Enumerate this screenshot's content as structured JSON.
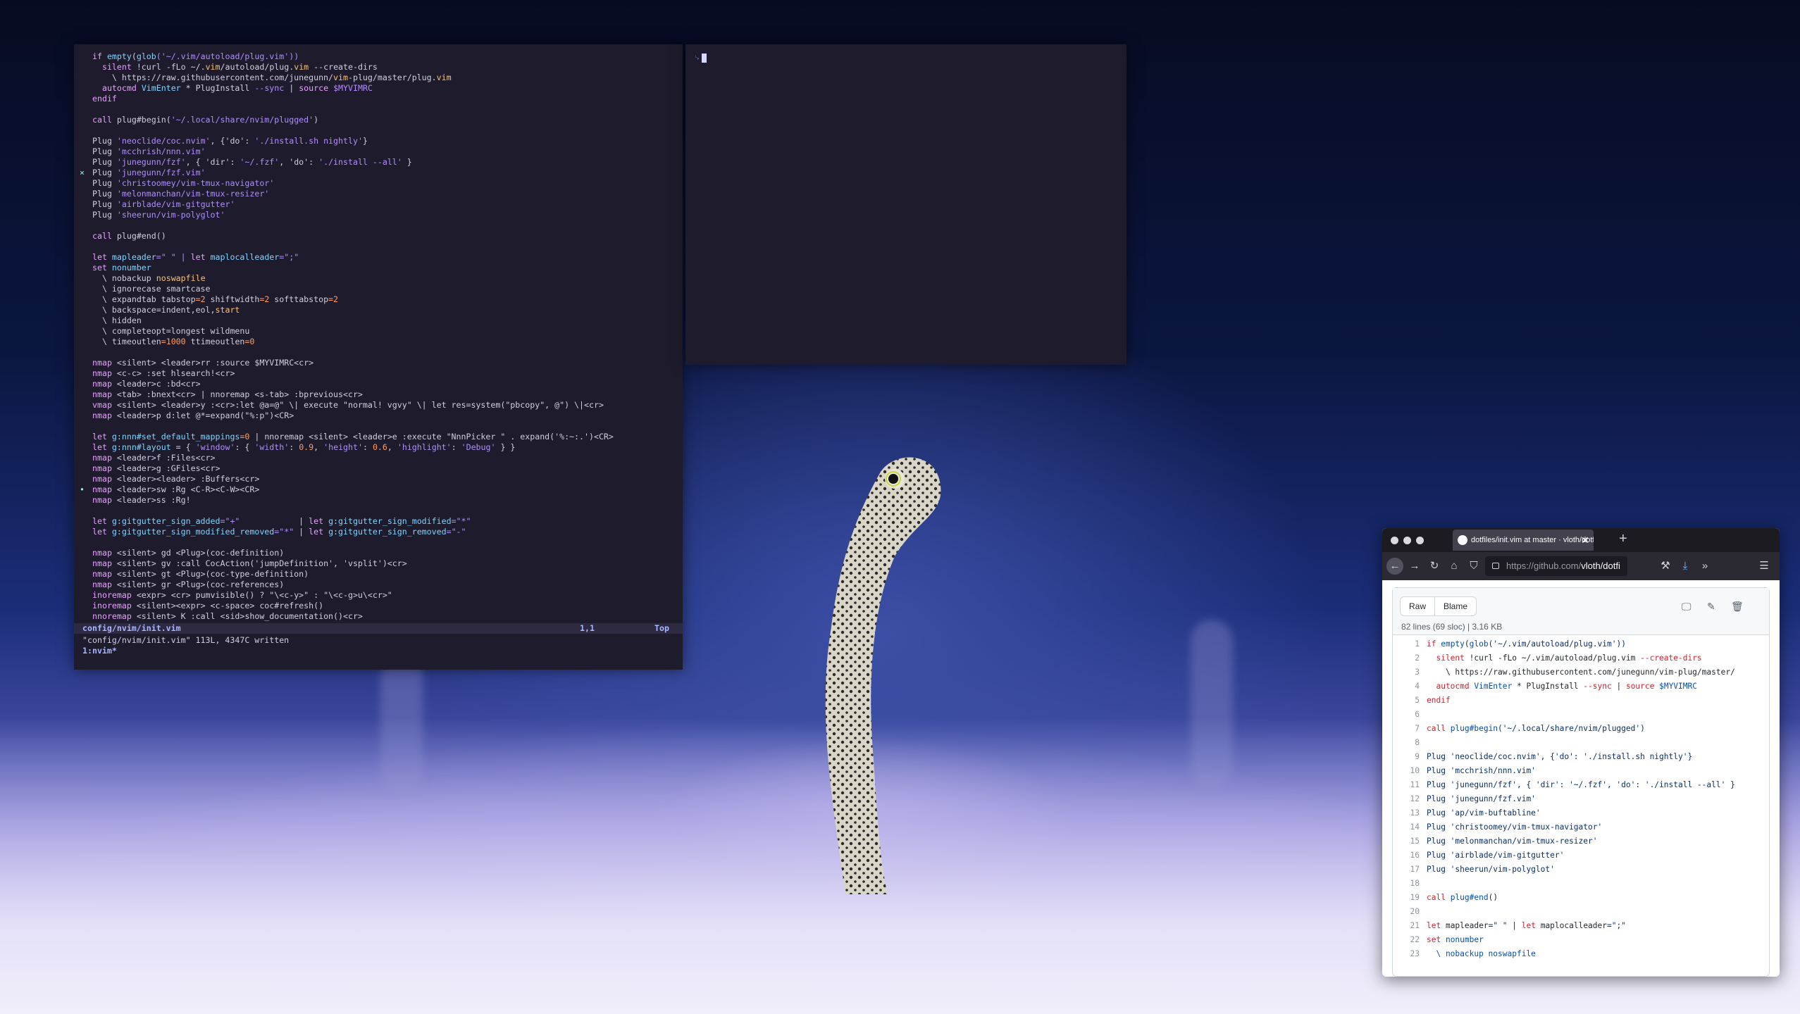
{
  "terminal": {
    "lines": [
      [
        {
          "t": "if ",
          "c": "k"
        },
        {
          "t": "empty",
          "c": "f"
        },
        {
          "t": "(",
          "c": ""
        },
        {
          "t": "glob",
          "c": "f"
        },
        {
          "t": "('~/.vim/autoload/plug.vim'))",
          "c": "s"
        }
      ],
      [
        {
          "t": "  silent ",
          "c": "k"
        },
        {
          "t": "!curl -fLo ~/.",
          "c": ""
        },
        {
          "t": "vim",
          "c": "o"
        },
        {
          "t": "/autoload/plug.",
          "c": ""
        },
        {
          "t": "vim",
          "c": "o"
        },
        {
          "t": " --create-dirs",
          "c": ""
        }
      ],
      [
        {
          "t": "    \\ https://raw.githubusercontent.com/junegunn/",
          "c": ""
        },
        {
          "t": "vim",
          "c": "o"
        },
        {
          "t": "-plug/master/plug.",
          "c": ""
        },
        {
          "t": "vim",
          "c": "o"
        }
      ],
      [
        {
          "t": "  autocmd ",
          "c": "k"
        },
        {
          "t": "VimEnter",
          "c": "f"
        },
        {
          "t": " * PlugInstall ",
          "c": ""
        },
        {
          "t": "--sync",
          "c": "s"
        },
        {
          "t": " | ",
          "c": ""
        },
        {
          "t": "source",
          "c": "k"
        },
        {
          "t": " $MYVIMRC",
          "c": "s"
        }
      ],
      [
        {
          "t": "endif",
          "c": "k"
        }
      ],
      [
        {
          "t": "",
          "c": ""
        }
      ],
      [
        {
          "t": "call ",
          "c": "k"
        },
        {
          "t": "plug#begin(",
          "c": ""
        },
        {
          "t": "'~/.local/share/nvim/plugged'",
          "c": "s"
        },
        {
          "t": ")",
          "c": ""
        }
      ],
      [
        {
          "t": "",
          "c": ""
        }
      ],
      [
        {
          "t": "Plug ",
          "c": ""
        },
        {
          "t": "'neoclide/coc.nvim'",
          "c": "s"
        },
        {
          "t": ", {'do': ",
          "c": ""
        },
        {
          "t": "'./install.sh nightly'",
          "c": "s"
        },
        {
          "t": "}",
          "c": ""
        }
      ],
      [
        {
          "t": "Plug ",
          "c": ""
        },
        {
          "t": "'mcchrish/nnn.vim'",
          "c": "s"
        }
      ],
      [
        {
          "t": "Plug ",
          "c": ""
        },
        {
          "t": "'junegunn/fzf'",
          "c": "s"
        },
        {
          "t": ", { 'dir': ",
          "c": ""
        },
        {
          "t": "'~/.fzf'",
          "c": "s"
        },
        {
          "t": ", 'do': ",
          "c": ""
        },
        {
          "t": "'./install --all'",
          "c": "s"
        },
        {
          "t": " }",
          "c": ""
        }
      ],
      [
        {
          "t": "Plug ",
          "c": ""
        },
        {
          "t": "'junegunn/fzf.vim'",
          "c": "s"
        }
      ],
      [
        {
          "t": "Plug ",
          "c": ""
        },
        {
          "t": "'christoomey/vim-tmux-navigator'",
          "c": "s"
        }
      ],
      [
        {
          "t": "Plug ",
          "c": ""
        },
        {
          "t": "'melonmanchan/vim-tmux-resizer'",
          "c": "s"
        }
      ],
      [
        {
          "t": "Plug ",
          "c": ""
        },
        {
          "t": "'airblade/vim-gitgutter'",
          "c": "s"
        }
      ],
      [
        {
          "t": "Plug ",
          "c": ""
        },
        {
          "t": "'sheerun/vim-polyglot'",
          "c": "s"
        }
      ],
      [
        {
          "t": "",
          "c": ""
        }
      ],
      [
        {
          "t": "call ",
          "c": "k"
        },
        {
          "t": "plug#end()",
          "c": ""
        }
      ],
      [
        {
          "t": "",
          "c": ""
        }
      ],
      [
        {
          "t": "let ",
          "c": "k"
        },
        {
          "t": "mapleader",
          "c": "f"
        },
        {
          "t": "=\" \" | ",
          "c": "s"
        },
        {
          "t": "let ",
          "c": "k"
        },
        {
          "t": "maplocalleader",
          "c": "f"
        },
        {
          "t": "=\";\"",
          "c": "s"
        }
      ],
      [
        {
          "t": "set ",
          "c": "k"
        },
        {
          "t": "nonumber",
          "c": "f"
        }
      ],
      [
        {
          "t": "  \\ nobackup ",
          "c": ""
        },
        {
          "t": "noswapfile",
          "c": "o"
        }
      ],
      [
        {
          "t": "  \\ ignorecase smartcase",
          "c": ""
        }
      ],
      [
        {
          "t": "  \\ expandtab tabstop",
          "c": ""
        },
        {
          "t": "=2",
          "c": "n"
        },
        {
          "t": " shiftwidth",
          "c": ""
        },
        {
          "t": "=2",
          "c": "n"
        },
        {
          "t": " softtabstop",
          "c": ""
        },
        {
          "t": "=2",
          "c": "n"
        }
      ],
      [
        {
          "t": "  \\ backspace=indent,eol,",
          "c": ""
        },
        {
          "t": "start",
          "c": "o"
        }
      ],
      [
        {
          "t": "  \\ hidden",
          "c": ""
        }
      ],
      [
        {
          "t": "  \\ completeopt=longest wildmenu",
          "c": ""
        }
      ],
      [
        {
          "t": "  \\ timeoutlen",
          "c": ""
        },
        {
          "t": "=1000",
          "c": "n"
        },
        {
          "t": " ttimeoutlen",
          "c": ""
        },
        {
          "t": "=0",
          "c": "n"
        }
      ],
      [
        {
          "t": "",
          "c": ""
        }
      ],
      [
        {
          "t": "nmap ",
          "c": "k"
        },
        {
          "t": "<silent> <leader>rr :source $MYVIMRC<cr>",
          "c": ""
        }
      ],
      [
        {
          "t": "nmap ",
          "c": "k"
        },
        {
          "t": "<c-c> :set hlsearch!<cr>",
          "c": ""
        }
      ],
      [
        {
          "t": "nmap ",
          "c": "k"
        },
        {
          "t": "<leader>c :bd<cr>",
          "c": ""
        }
      ],
      [
        {
          "t": "nmap ",
          "c": "k"
        },
        {
          "t": "<tab> :bnext<cr> | nnoremap <s-tab> :bprevious<cr>",
          "c": ""
        }
      ],
      [
        {
          "t": "vmap ",
          "c": "k"
        },
        {
          "t": "<silent> <leader>y :<cr>:let @a=@\" \\| execute \"normal! vgvy\" \\| let res=system(\"pbcopy\", @\") \\|<cr>",
          "c": ""
        }
      ],
      [
        {
          "t": "nmap ",
          "c": "k"
        },
        {
          "t": "<leader>p d:let @*=expand(\"%:p\")<CR>",
          "c": ""
        }
      ],
      [
        {
          "t": "",
          "c": ""
        }
      ],
      [
        {
          "t": "let ",
          "c": "k"
        },
        {
          "t": "g:nnn#set_default_mappings",
          "c": "f"
        },
        {
          "t": "=0",
          "c": "n"
        },
        {
          "t": " | nnoremap <silent> <leader>e :execute \"NnnPicker \" . expand('%:~:.')<CR>",
          "c": ""
        }
      ],
      [
        {
          "t": "let ",
          "c": "k"
        },
        {
          "t": "g:nnn#layout",
          "c": "f"
        },
        {
          "t": " = { ",
          "c": ""
        },
        {
          "t": "'window'",
          "c": "s"
        },
        {
          "t": ": { ",
          "c": ""
        },
        {
          "t": "'width'",
          "c": "s"
        },
        {
          "t": ": ",
          "c": ""
        },
        {
          "t": "0.9",
          "c": "n"
        },
        {
          "t": ", ",
          "c": ""
        },
        {
          "t": "'height'",
          "c": "s"
        },
        {
          "t": ": ",
          "c": ""
        },
        {
          "t": "0.6",
          "c": "n"
        },
        {
          "t": ", ",
          "c": ""
        },
        {
          "t": "'highlight'",
          "c": "s"
        },
        {
          "t": ": ",
          "c": ""
        },
        {
          "t": "'Debug'",
          "c": "s"
        },
        {
          "t": " } }",
          "c": ""
        }
      ],
      [
        {
          "t": "nmap ",
          "c": "k"
        },
        {
          "t": "<leader>f :Files<cr>",
          "c": ""
        }
      ],
      [
        {
          "t": "nmap ",
          "c": "k"
        },
        {
          "t": "<leader>g :GFiles<cr>",
          "c": ""
        }
      ],
      [
        {
          "t": "nmap ",
          "c": "k"
        },
        {
          "t": "<leader><leader> :Buffers<cr>",
          "c": ""
        }
      ],
      [
        {
          "t": "nmap ",
          "c": "k"
        },
        {
          "t": "<leader>sw :Rg <C-R><C-W><CR>",
          "c": ""
        }
      ],
      [
        {
          "t": "nmap ",
          "c": "k"
        },
        {
          "t": "<leader>ss :Rg!",
          "c": ""
        }
      ],
      [
        {
          "t": "",
          "c": ""
        }
      ],
      [
        {
          "t": "let ",
          "c": "k"
        },
        {
          "t": "g:gitgutter_sign_added",
          "c": "f"
        },
        {
          "t": "=\"+\"",
          "c": "s"
        },
        {
          "t": "            | ",
          "c": ""
        },
        {
          "t": "let ",
          "c": "k"
        },
        {
          "t": "g:gitgutter_sign_modified",
          "c": "f"
        },
        {
          "t": "=\"*\"",
          "c": "s"
        }
      ],
      [
        {
          "t": "let ",
          "c": "k"
        },
        {
          "t": "g:gitgutter_sign_modified_removed",
          "c": "f"
        },
        {
          "t": "=\"*\"",
          "c": "s"
        },
        {
          "t": " | ",
          "c": ""
        },
        {
          "t": "let ",
          "c": "k"
        },
        {
          "t": "g:gitgutter_sign_removed",
          "c": "f"
        },
        {
          "t": "=\"-\"",
          "c": "s"
        }
      ],
      [
        {
          "t": "",
          "c": ""
        }
      ],
      [
        {
          "t": "nmap ",
          "c": "k"
        },
        {
          "t": "<silent> gd <Plug>(coc-definition)",
          "c": ""
        }
      ],
      [
        {
          "t": "nmap ",
          "c": "k"
        },
        {
          "t": "<silent> gv :call CocAction('jumpDefinition', 'vsplit')<cr>",
          "c": ""
        }
      ],
      [
        {
          "t": "nmap ",
          "c": "k"
        },
        {
          "t": "<silent> gt <Plug>(coc-type-definition)",
          "c": ""
        }
      ],
      [
        {
          "t": "nmap ",
          "c": "k"
        },
        {
          "t": "<silent> gr <Plug>(coc-references)",
          "c": ""
        }
      ],
      [
        {
          "t": "inoremap ",
          "c": "k"
        },
        {
          "t": "<expr> <cr> pumvisible() ? \"\\<c-y>\" : \"\\<c-g>u\\<cr>\"",
          "c": ""
        }
      ],
      [
        {
          "t": "inoremap ",
          "c": "k"
        },
        {
          "t": "<silent><expr> <c-space> coc#refresh()",
          "c": ""
        }
      ],
      [
        {
          "t": "nnoremap ",
          "c": "k"
        },
        {
          "t": "<silent> K :call <sid>show_documentation()<cr>",
          "c": ""
        }
      ]
    ],
    "gutter_marks": {
      "11": "×",
      "41": "•"
    },
    "status_file": "config/nvim/init.vim",
    "status_pos": "1,1",
    "status_scroll": "Top",
    "message": "\"config/nvim/init.vim\" 113L, 4347C written",
    "tmux_window": "1:nvim*"
  },
  "terminal2": {
    "prompt": "␊"
  },
  "browser": {
    "tab_title": "dotfiles/init.vim at master · vloth/dotfiles",
    "url_host": "https://github.com/",
    "url_path": "vloth/dotfi",
    "raw_label": "Raw",
    "blame_label": "Blame",
    "lines_info": "82 lines (69 sloc)  |  3.16 KB",
    "icons": [
      "desktop-icon",
      "pencil-icon",
      "trash-icon"
    ],
    "code": [
      {
        "n": "1",
        "h": [
          {
            "t": "if ",
            "c": "gk"
          },
          {
            "t": "empty",
            "c": "gf"
          },
          {
            "t": "(",
            "c": ""
          },
          {
            "t": "glob",
            "c": "gf"
          },
          {
            "t": "('~/.vim/autoload/plug.vim'))",
            "c": "gs"
          }
        ]
      },
      {
        "n": "2",
        "h": [
          {
            "t": "  silent ",
            "c": "gk"
          },
          {
            "t": "!curl -fLo ~/.vim/autoload/plug.vim ",
            "c": ""
          },
          {
            "t": "--create-dirs",
            "c": "gk"
          }
        ]
      },
      {
        "n": "3",
        "h": [
          {
            "t": "    \\ https://raw.githubusercontent.com/junegunn/vim-plug/master/",
            "c": ""
          }
        ]
      },
      {
        "n": "4",
        "h": [
          {
            "t": "  autocmd ",
            "c": "gk"
          },
          {
            "t": "VimEnter",
            "c": "gf"
          },
          {
            "t": " * PlugInstall ",
            "c": ""
          },
          {
            "t": "--sync",
            "c": "gk"
          },
          {
            "t": " | ",
            "c": ""
          },
          {
            "t": "source",
            "c": "gk"
          },
          {
            "t": " $MYVIMRC",
            "c": "gf"
          }
        ]
      },
      {
        "n": "5",
        "h": [
          {
            "t": "endif",
            "c": "gk"
          }
        ]
      },
      {
        "n": "6",
        "h": []
      },
      {
        "n": "7",
        "h": [
          {
            "t": "call ",
            "c": "gk"
          },
          {
            "t": "plug#begin",
            "c": "gf"
          },
          {
            "t": "('~/.local/share/nvim/plugged')",
            "c": "gs"
          }
        ]
      },
      {
        "n": "8",
        "h": []
      },
      {
        "n": "9",
        "h": [
          {
            "t": "Plug 'neoclide/coc.nvim', {'do': './install.sh nightly'}",
            "c": "gs"
          }
        ]
      },
      {
        "n": "10",
        "h": [
          {
            "t": "Plug 'mcchrish/nnn.vim'",
            "c": "gs"
          }
        ]
      },
      {
        "n": "11",
        "h": [
          {
            "t": "Plug 'junegunn/fzf', { 'dir': '~/.fzf', 'do': './install --all' }",
            "c": "gs"
          }
        ]
      },
      {
        "n": "12",
        "h": [
          {
            "t": "Plug 'junegunn/fzf.vim'",
            "c": "gs"
          }
        ]
      },
      {
        "n": "13",
        "h": [
          {
            "t": "Plug 'ap/vim-buftabline'",
            "c": "gs"
          }
        ]
      },
      {
        "n": "14",
        "h": [
          {
            "t": "Plug 'christoomey/vim-tmux-navigator'",
            "c": "gs"
          }
        ]
      },
      {
        "n": "15",
        "h": [
          {
            "t": "Plug 'melonmanchan/vim-tmux-resizer'",
            "c": "gs"
          }
        ]
      },
      {
        "n": "16",
        "h": [
          {
            "t": "Plug 'airblade/vim-gitgutter'",
            "c": "gs"
          }
        ]
      },
      {
        "n": "17",
        "h": [
          {
            "t": "Plug 'sheerun/vim-polyglot'",
            "c": "gs"
          }
        ]
      },
      {
        "n": "18",
        "h": []
      },
      {
        "n": "19",
        "h": [
          {
            "t": "call ",
            "c": "gk"
          },
          {
            "t": "plug#end",
            "c": "gf"
          },
          {
            "t": "()",
            "c": ""
          }
        ]
      },
      {
        "n": "20",
        "h": []
      },
      {
        "n": "21",
        "h": [
          {
            "t": "let ",
            "c": "gk"
          },
          {
            "t": "mapleader",
            "c": ""
          },
          {
            "t": "=\" \"",
            "c": "gs"
          },
          {
            "t": " | ",
            "c": ""
          },
          {
            "t": "let ",
            "c": "gk"
          },
          {
            "t": "maplocalleader",
            "c": ""
          },
          {
            "t": "=\";\"",
            "c": "gs"
          }
        ]
      },
      {
        "n": "22",
        "h": [
          {
            "t": "set ",
            "c": "gk"
          },
          {
            "t": "nonumber",
            "c": "gf"
          }
        ]
      },
      {
        "n": "23",
        "h": [
          {
            "t": "  \\ nobackup noswapfile",
            "c": "gf"
          }
        ]
      }
    ]
  }
}
